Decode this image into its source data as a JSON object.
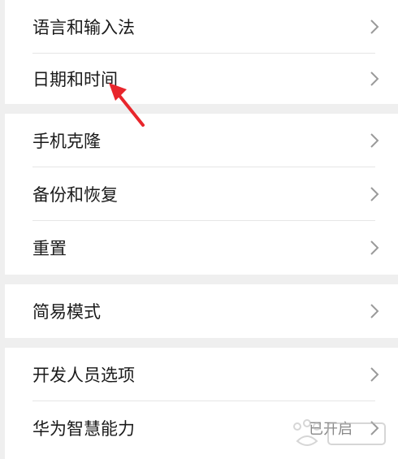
{
  "groups": [
    {
      "items": [
        {
          "label": "语言和输入法"
        },
        {
          "label": "日期和时间"
        }
      ]
    },
    {
      "items": [
        {
          "label": "手机克隆"
        },
        {
          "label": "备份和恢复"
        },
        {
          "label": "重置"
        }
      ]
    },
    {
      "items": [
        {
          "label": "简易模式"
        }
      ]
    },
    {
      "items": [
        {
          "label": "开发人员选项"
        },
        {
          "label": "华为智慧能力",
          "trailing": "已开启"
        }
      ]
    }
  ],
  "colors": {
    "background": "#efefef",
    "card": "#ffffff",
    "text": "#1a1a1a",
    "chevron": "#9a9a9a",
    "annotation_arrow": "#e8262c"
  },
  "icons": {
    "chevron": "chevron-right-icon",
    "annotation": "red-arrow-annotation-icon",
    "watermark": "baidu-jingyan-watermark"
  }
}
